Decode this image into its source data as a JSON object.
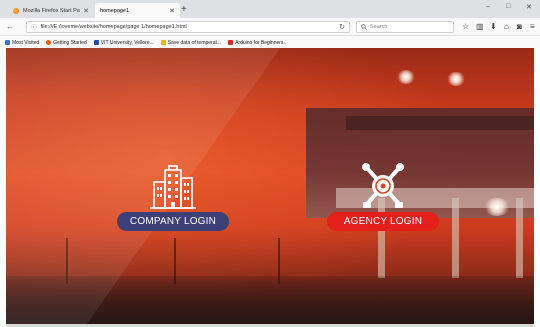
{
  "browser": {
    "tabs": [
      {
        "label": "Mozilla Firefox Start Page",
        "active": false
      },
      {
        "label": "homepage1",
        "active": true
      }
    ],
    "new_tab_label": "+",
    "window_controls": {
      "minimize": "–",
      "restore": "□",
      "close": "✕"
    },
    "nav": {
      "back": "←",
      "info": "ⓘ"
    },
    "url": "file:///E:/loveme/website/homepage/page 1/homepage1.html",
    "reload_icon": "↻",
    "search_placeholder": "Search",
    "search_icon": "search-icon",
    "toolbar_icons": [
      "star-icon",
      "library-icon",
      "download-icon",
      "home-icon",
      "pocket-icon",
      "menu-icon"
    ],
    "bookmarks": [
      {
        "label": "Most Visited",
        "color": "#3b73c9"
      },
      {
        "label": "Getting Started",
        "color": "#e66000"
      },
      {
        "label": "VIT University, Vellore...",
        "color": "#1d4fa0"
      },
      {
        "label": "Save data of temperat...",
        "color": "#f4b400"
      },
      {
        "label": "Arduino for Beginners...",
        "color": "#d62d20"
      }
    ]
  },
  "page": {
    "company": {
      "label": "COMPANY LOGIN",
      "icon": "building-icon",
      "color": "#3c3f78"
    },
    "agency": {
      "label": "AGENCY LOGIN",
      "icon": "tools-emblem-icon",
      "color": "#e3201b"
    }
  }
}
